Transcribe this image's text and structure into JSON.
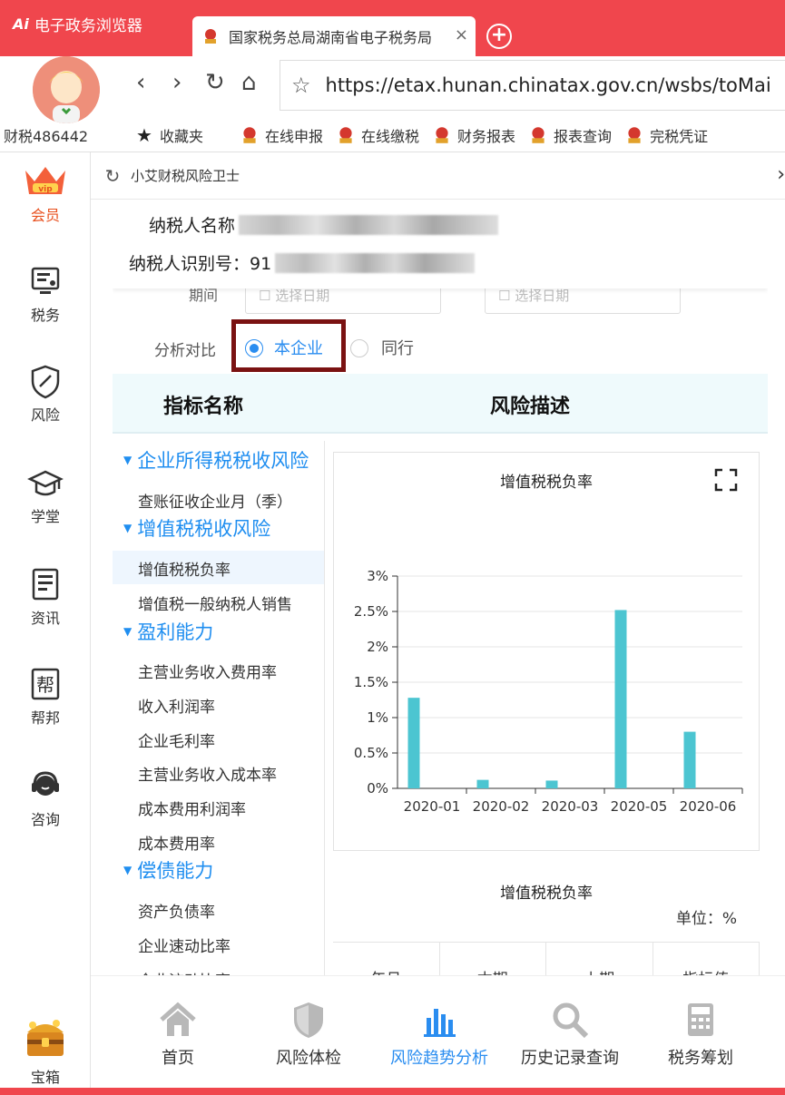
{
  "browser": {
    "brand_logo": "Ai",
    "brand_name": "电子政务浏览器",
    "tab_title": "国家税务总局湖南省电子税务局",
    "tab_close": "×",
    "new_tab": "+",
    "url": "https://etax.hunan.chinatax.gov.cn/wsbs/toMai",
    "user": "财税486442",
    "favorites": "收藏夹",
    "bookmarks": [
      "在线申报",
      "在线缴税",
      "财务报表",
      "报表查询",
      "完税凭证"
    ]
  },
  "sidebar": {
    "items": [
      {
        "label": "会员",
        "icon": "vip-crown-icon"
      },
      {
        "label": "税务",
        "icon": "monitor-icon"
      },
      {
        "label": "风险",
        "icon": "shield-icon"
      },
      {
        "label": "学堂",
        "icon": "graduation-cap-icon"
      },
      {
        "label": "资讯",
        "icon": "news-icon"
      },
      {
        "label": "帮邦",
        "icon": "help-icon"
      },
      {
        "label": "咨询",
        "icon": "headset-icon"
      },
      {
        "label": "宝箱",
        "icon": "treasure-chest-icon"
      }
    ]
  },
  "panel": {
    "title": "小艾财税风险卫士",
    "taxpayer_name_label": "纳税人名称",
    "taxpayer_id_label": "纳税人识别号：91",
    "period_label": "期间",
    "date_placeholder": "选择日期",
    "compare_label": "分析对比",
    "compare_options": [
      "本企业",
      "同行"
    ],
    "compare_selected": "本企业",
    "table_header": {
      "col1": "指标名称",
      "col2": "风险描述"
    }
  },
  "tree": [
    {
      "type": "group",
      "label": "企业所得税税收风险"
    },
    {
      "type": "leaf",
      "label": "查账征收企业月（季）"
    },
    {
      "type": "group",
      "label": "增值税税收风险"
    },
    {
      "type": "leaf",
      "label": "增值税税负率",
      "selected": true
    },
    {
      "type": "leaf",
      "label": "增值税一般纳税人销售"
    },
    {
      "type": "group",
      "label": "盈利能力"
    },
    {
      "type": "leaf",
      "label": "主营业务收入费用率"
    },
    {
      "type": "leaf",
      "label": "收入利润率"
    },
    {
      "type": "leaf",
      "label": "企业毛利率"
    },
    {
      "type": "leaf",
      "label": "主营业务收入成本率"
    },
    {
      "type": "leaf",
      "label": "成本费用利润率"
    },
    {
      "type": "leaf",
      "label": "成本费用率"
    },
    {
      "type": "group",
      "label": "偿债能力"
    },
    {
      "type": "leaf",
      "label": "资产负债率"
    },
    {
      "type": "leaf",
      "label": "企业速动比率"
    },
    {
      "type": "leaf",
      "label": "企业流动比率"
    }
  ],
  "chart_data": {
    "type": "bar",
    "title": "增值税税负率",
    "categories": [
      "2020-01",
      "2020-02",
      "2020-03",
      "2020-05",
      "2020-06"
    ],
    "values": [
      1.28,
      0.12,
      0.11,
      2.52,
      0.8
    ],
    "ylim": [
      0,
      3
    ],
    "yticks": [
      "0%",
      "0.5%",
      "1%",
      "1.5%",
      "2%",
      "2.5%",
      "3%"
    ],
    "xlabel": "",
    "ylabel": "",
    "bar_color": "#4cc5d1",
    "grid": true
  },
  "data_table": {
    "title": "增值税税负率",
    "unit": "单位：%",
    "headers": [
      "年月",
      "本期",
      "上期",
      "指标值"
    ]
  },
  "bottom_nav": [
    {
      "label": "首页",
      "icon": "home-icon"
    },
    {
      "label": "风险体检",
      "icon": "shield-check-icon"
    },
    {
      "label": "风险趋势分析",
      "icon": "bar-chart-icon",
      "active": true
    },
    {
      "label": "历史记录查询",
      "icon": "search-icon"
    },
    {
      "label": "税务筹划",
      "icon": "calculator-icon"
    }
  ],
  "colors": {
    "accent": "#f0464d",
    "link": "#2a8df0",
    "highlight_box": "#7a1212"
  }
}
